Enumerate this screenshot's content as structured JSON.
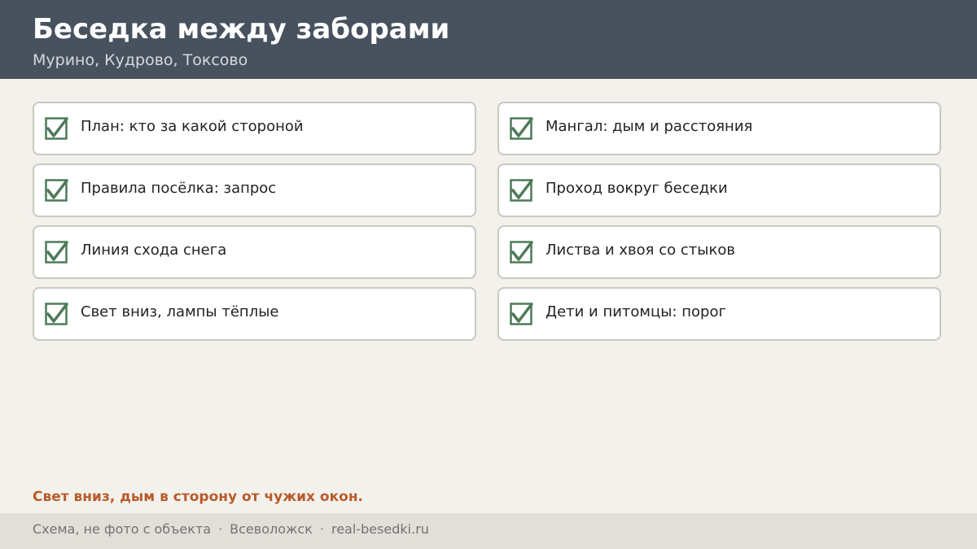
{
  "header": {
    "title": "Беседка между заборами",
    "subtitle": "Мурино, Кудрово, Токсово"
  },
  "checklist": [
    {
      "label": "План: кто за какой стороной",
      "checked": true,
      "icon": "checkbox-checked-icon"
    },
    {
      "label": "Мангал: дым и расстояния",
      "checked": true,
      "icon": "checkbox-checked-icon"
    },
    {
      "label": "Правила посёлка: запрос",
      "checked": true,
      "icon": "checkbox-checked-icon"
    },
    {
      "label": "Проход вокруг беседки",
      "checked": true,
      "icon": "checkbox-checked-icon"
    },
    {
      "label": "Линия схода снега",
      "checked": true,
      "icon": "checkbox-checked-icon"
    },
    {
      "label": "Листва и хвоя со стыков",
      "checked": true,
      "icon": "checkbox-checked-icon"
    },
    {
      "label": "Свет вниз, лампы тёплые",
      "checked": true,
      "icon": "checkbox-checked-icon"
    },
    {
      "label": "Дети и питомцы: порог",
      "checked": true,
      "icon": "checkbox-checked-icon"
    }
  ],
  "note": "Свет вниз, дым в сторону от чужих окон.",
  "footer": {
    "caption": "Схема, не фото с объекта",
    "separator": "·",
    "city": "Всеволожск",
    "site": "real-besedki.ru"
  },
  "colors": {
    "header_bg": "#48525f",
    "page_bg": "#f3f1ec",
    "accent_note": "#b85b2c",
    "check_green": "#4e7a58"
  }
}
